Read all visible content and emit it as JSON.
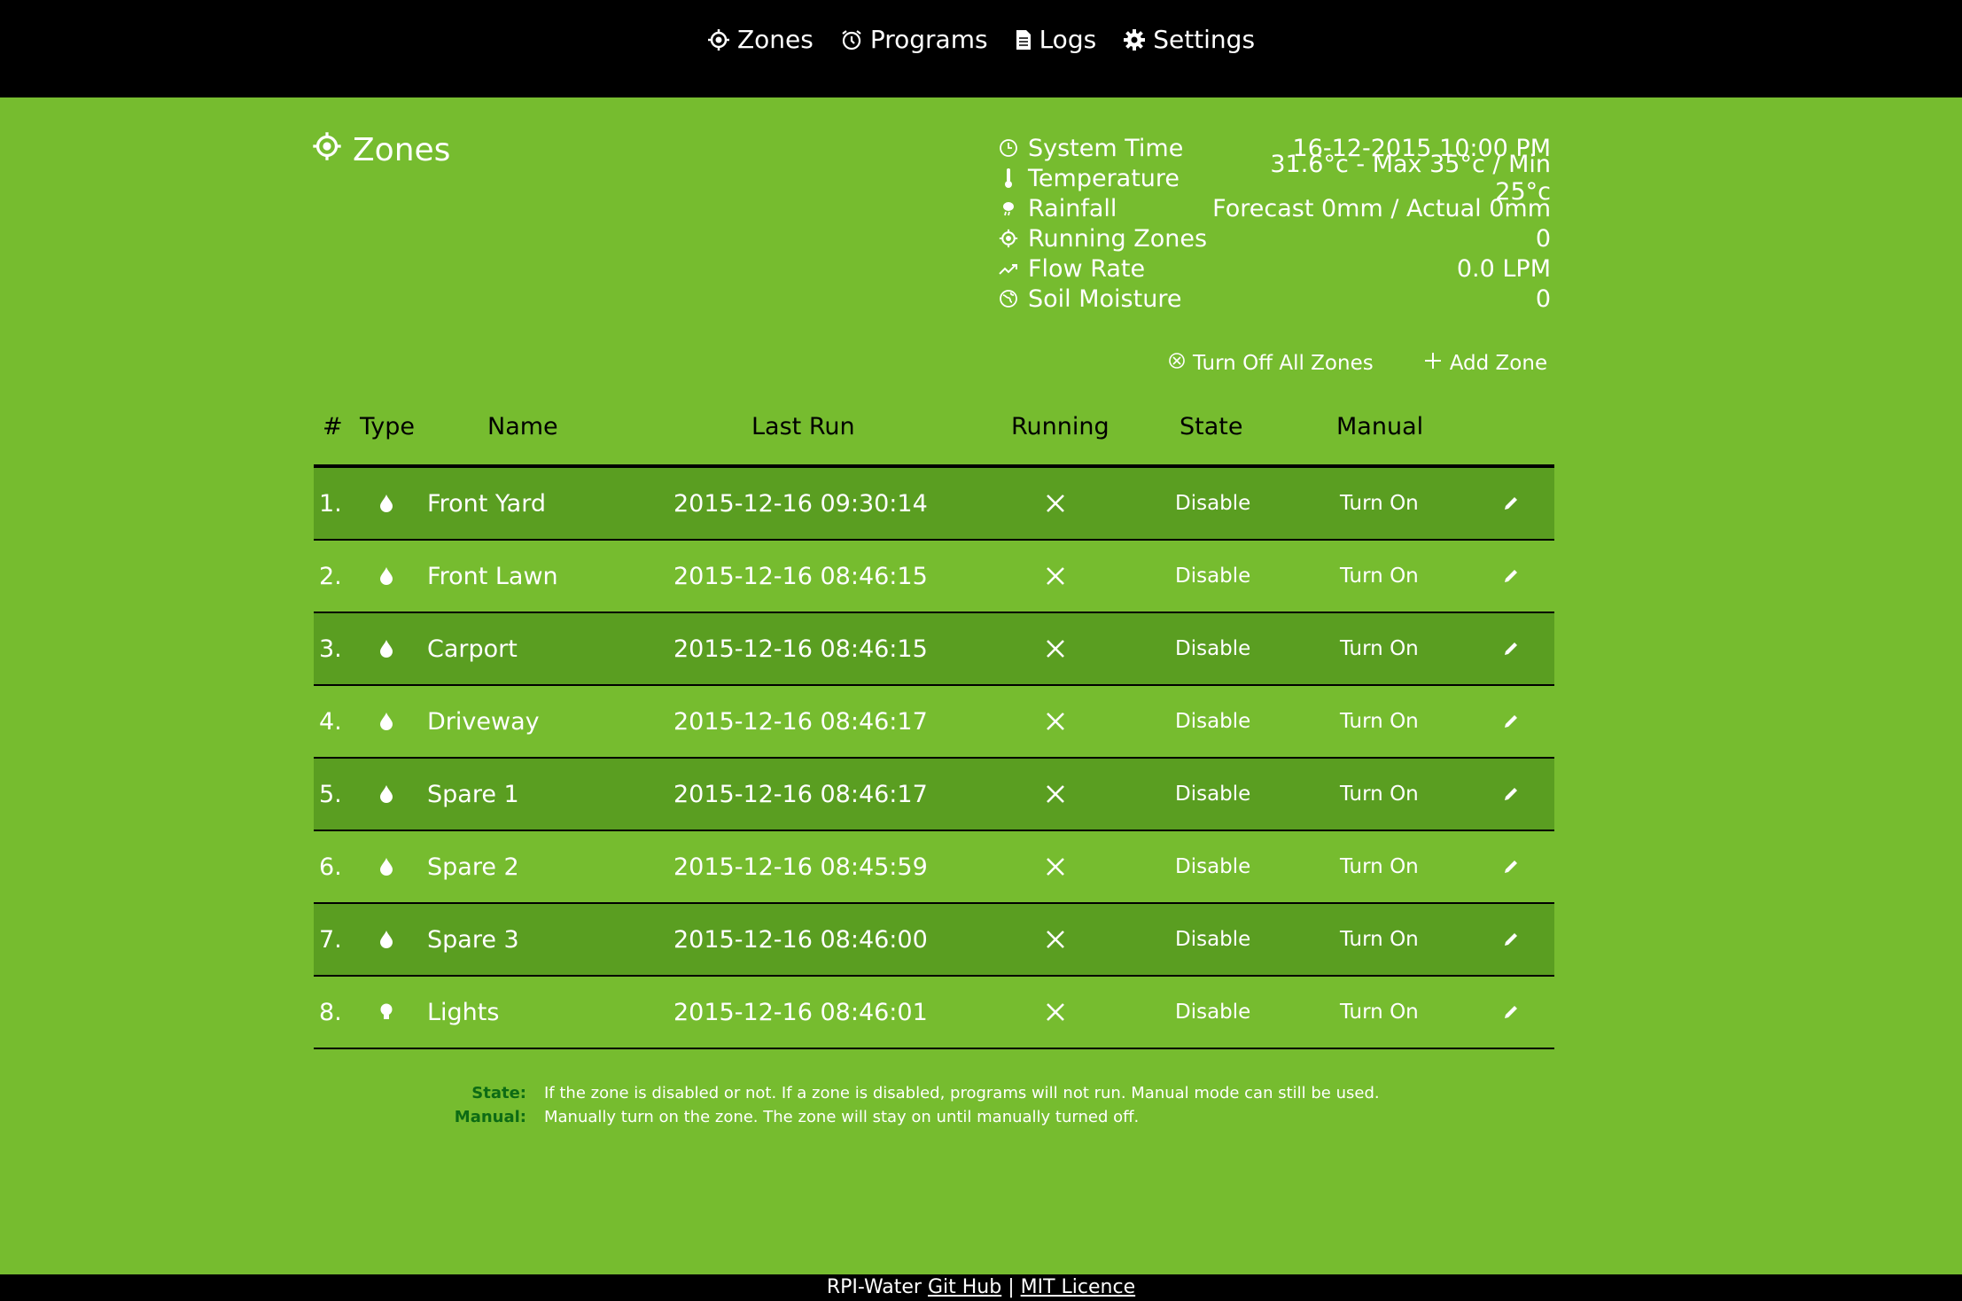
{
  "nav": {
    "items": [
      {
        "label": "Zones",
        "icon": "target-icon"
      },
      {
        "label": "Programs",
        "icon": "alarm-clock-icon"
      },
      {
        "label": "Logs",
        "icon": "document-icon"
      },
      {
        "label": "Settings",
        "icon": "gear-icon"
      }
    ]
  },
  "page": {
    "title": "Zones"
  },
  "status": {
    "system_time_label": "System Time",
    "system_time_value": "16-12-2015 10:00 PM",
    "temperature_label": "Temperature",
    "temperature_value": "31.6°c - Max 35°c / Min 25°c",
    "rainfall_label": "Rainfall",
    "rainfall_value": "Forecast 0mm / Actual 0mm",
    "running_zones_label": "Running Zones",
    "running_zones_value": "0",
    "flow_rate_label": "Flow Rate",
    "flow_rate_value": "0.0 LPM",
    "soil_moisture_label": "Soil Moisture",
    "soil_moisture_value": "0"
  },
  "actions": {
    "turn_off_all": "Turn Off All Zones",
    "add_zone": "Add Zone"
  },
  "table": {
    "headers": {
      "num": "#",
      "type": "Type",
      "name": "Name",
      "last_run": "Last Run",
      "running": "Running",
      "state": "State",
      "manual": "Manual"
    },
    "rows": [
      {
        "num": "1.",
        "type": "water-drop-icon",
        "name": "Front Yard",
        "last_run": "2015-12-16 09:30:14",
        "state": "Disable",
        "manual": "Turn On"
      },
      {
        "num": "2.",
        "type": "water-drop-icon",
        "name": "Front Lawn",
        "last_run": "2015-12-16 08:46:15",
        "state": "Disable",
        "manual": "Turn On"
      },
      {
        "num": "3.",
        "type": "water-drop-icon",
        "name": "Carport",
        "last_run": "2015-12-16 08:46:15",
        "state": "Disable",
        "manual": "Turn On"
      },
      {
        "num": "4.",
        "type": "water-drop-icon",
        "name": "Driveway",
        "last_run": "2015-12-16 08:46:17",
        "state": "Disable",
        "manual": "Turn On"
      },
      {
        "num": "5.",
        "type": "water-drop-icon",
        "name": "Spare 1",
        "last_run": "2015-12-16 08:46:17",
        "state": "Disable",
        "manual": "Turn On"
      },
      {
        "num": "6.",
        "type": "water-drop-icon",
        "name": "Spare 2",
        "last_run": "2015-12-16 08:45:59",
        "state": "Disable",
        "manual": "Turn On"
      },
      {
        "num": "7.",
        "type": "water-drop-icon",
        "name": "Spare 3",
        "last_run": "2015-12-16 08:46:00",
        "state": "Disable",
        "manual": "Turn On"
      },
      {
        "num": "8.",
        "type": "lightbulb-icon",
        "name": "Lights",
        "last_run": "2015-12-16 08:46:01",
        "state": "Disable",
        "manual": "Turn On"
      }
    ]
  },
  "legend": {
    "state_term": "State:",
    "state_desc": "If the zone is disabled or not. If a zone is disabled, programs will not run. Manual mode can still be used.",
    "manual_term": "Manual:",
    "manual_desc": "Manually turn on the zone. The zone will stay on until manually turned off."
  },
  "footer": {
    "app_name": "RPI-Water",
    "github_link": "Git Hub",
    "separator": "|",
    "licence_link": "MIT Licence"
  },
  "colors": {
    "background": "#76bc2f",
    "row_stripe": "#5a9e21",
    "bar": "#000000",
    "legend_term": "#0d6b14"
  }
}
